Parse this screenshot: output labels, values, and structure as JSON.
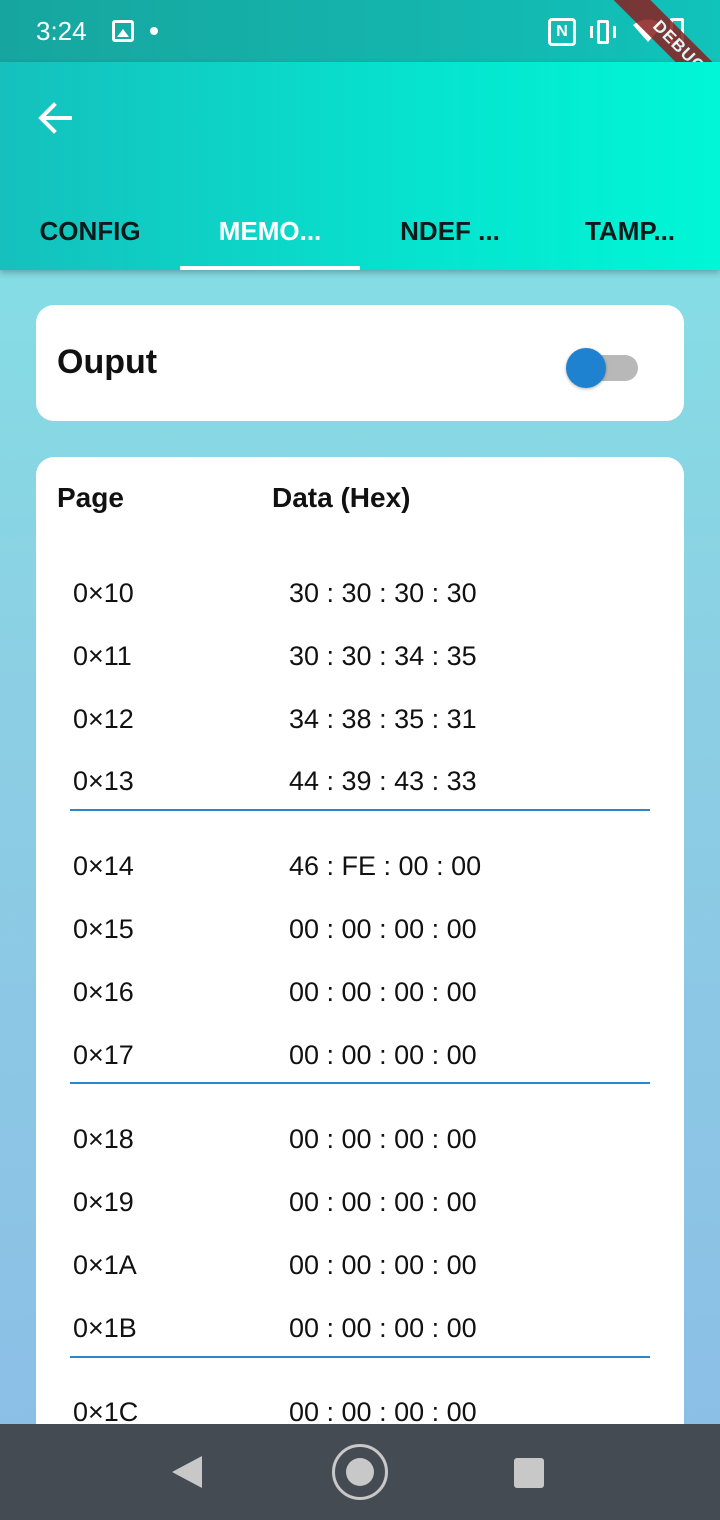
{
  "status_bar": {
    "time": "3:24",
    "icons": [
      "image-icon",
      "dot-icon",
      "nfc-icon",
      "vibrate-icon",
      "wifi-icon",
      "battery-icon"
    ]
  },
  "debug_banner": "DEBUG",
  "app_bar": {
    "back_icon": "arrow-left-icon",
    "tabs": [
      {
        "label": "CONFIG",
        "active": false
      },
      {
        "label": "MEMO...",
        "active": true
      },
      {
        "label": "NDEF ...",
        "active": false
      },
      {
        "label": "TAMP...",
        "active": false
      }
    ]
  },
  "output_card": {
    "label": "Ouput",
    "toggle_on": false
  },
  "memory_card": {
    "page_header": "Page",
    "data_header": "Data (Hex)",
    "rows": [
      {
        "page": "0×10",
        "data": "30 : 30 : 30 : 30"
      },
      {
        "page": "0×11",
        "data": "30 : 30 : 34 : 35"
      },
      {
        "page": "0×12",
        "data": "34 : 38 : 35 : 31"
      },
      {
        "page": "0×13",
        "data": "44 : 39 : 43 : 33"
      },
      {
        "page": "0×14",
        "data": "46 : FE : 00 : 00"
      },
      {
        "page": "0×15",
        "data": "00 : 00 : 00 : 00"
      },
      {
        "page": "0×16",
        "data": "00 : 00 : 00 : 00"
      },
      {
        "page": "0×17",
        "data": "00 : 00 : 00 : 00"
      },
      {
        "page": "0×18",
        "data": "00 : 00 : 00 : 00"
      },
      {
        "page": "0×19",
        "data": "00 : 00 : 00 : 00"
      },
      {
        "page": "0×1A",
        "data": "00 : 00 : 00 : 00"
      },
      {
        "page": "0×1B",
        "data": "00 : 00 : 00 : 00"
      },
      {
        "page": "0×1C",
        "data": "00 : 00 : 00 : 00"
      }
    ]
  },
  "colors": {
    "accent": "#1e82d0",
    "divider": "#2d86cc",
    "appbar_start": "#15c0bd",
    "appbar_end": "#00f6d6"
  }
}
